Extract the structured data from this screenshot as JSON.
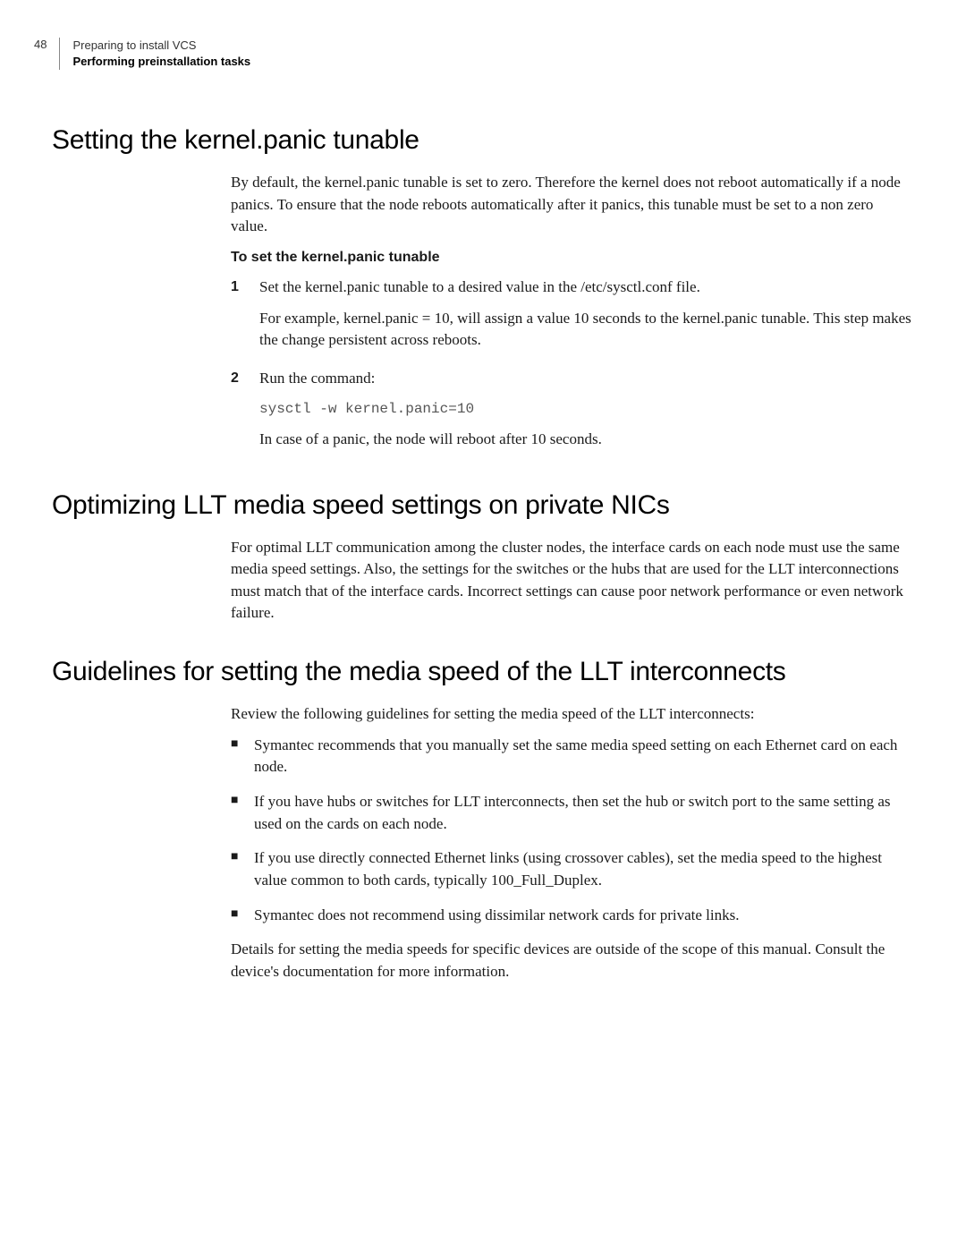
{
  "header": {
    "page_number": "48",
    "line1": "Preparing to install VCS",
    "line2": "Performing preinstallation tasks"
  },
  "section1": {
    "title": "Setting the kernel.panic tunable",
    "intro": "By default, the kernel.panic tunable is set to zero. Therefore the kernel does not reboot automatically if a node panics. To ensure that the node reboots automatically after it panics, this tunable must be set to a non zero value.",
    "subheading": "To set the kernel.panic tunable",
    "step1_num": "1",
    "step1_text": "Set the kernel.panic tunable to a desired value in the /etc/sysctl.conf file.",
    "step1_para2": "For example, kernel.panic = 10, will assign a value 10 seconds to the kernel.panic tunable. This step makes the change persistent across reboots.",
    "step2_num": "2",
    "step2_text": "Run the command:",
    "step2_code": "sysctl -w kernel.panic=10",
    "step2_after": "In case of a panic, the node will reboot after 10 seconds."
  },
  "section2": {
    "title": "Optimizing LLT media speed settings on private NICs",
    "para": "For optimal LLT communication among the cluster nodes, the interface cards on each node must use the same media speed settings. Also, the settings for the switches or the hubs that are used for the LLT interconnections must match that of the interface cards. Incorrect settings can cause poor network performance or even network failure."
  },
  "section3": {
    "title": "Guidelines for setting the media speed of the LLT interconnects",
    "intro": "Review the following guidelines for setting the media speed of the LLT interconnects:",
    "bullets": [
      "Symantec recommends that you manually set the same media speed setting on each Ethernet card on each node.",
      "If you have hubs or switches for LLT interconnects, then set the hub or switch port to the same setting as used on the cards on each node.",
      "If you use directly connected Ethernet links (using crossover cables), set the media speed to the highest value common to both cards, typically 100_Full_Duplex.",
      "Symantec does not recommend using dissimilar network cards for private links."
    ],
    "closing": "Details for setting the media speeds for specific devices are outside of the scope of this manual. Consult the device's documentation for more information."
  }
}
